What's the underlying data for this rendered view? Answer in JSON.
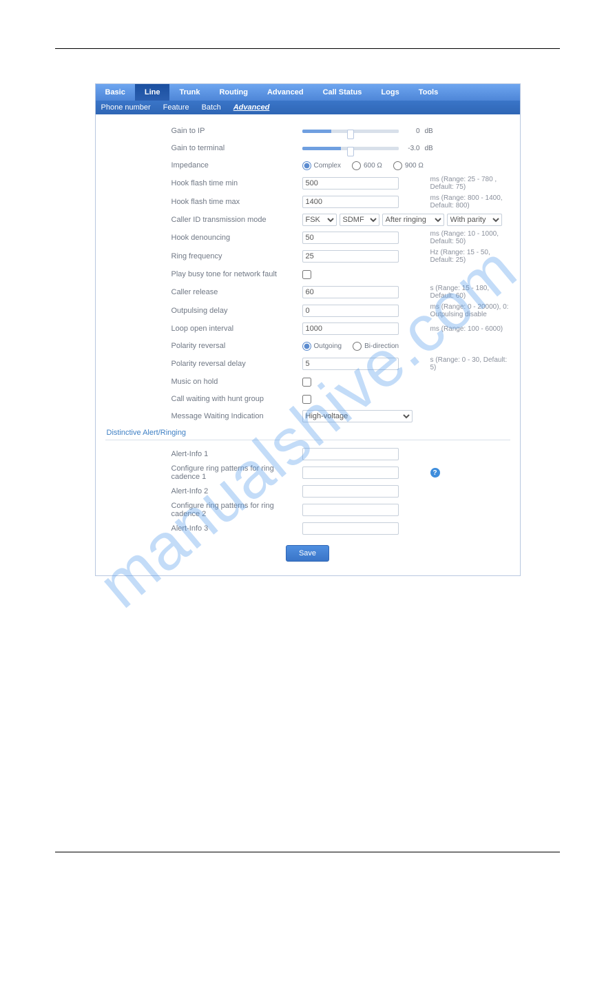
{
  "watermark": "manualshive.com",
  "tabs": [
    "Basic",
    "Line",
    "Trunk",
    "Routing",
    "Advanced",
    "Call Status",
    "Logs",
    "Tools"
  ],
  "active_tab": "Line",
  "subtabs": [
    "Phone number",
    "Feature",
    "Batch",
    "Advanced"
  ],
  "active_subtab": "Advanced",
  "form": {
    "gain_to_ip": {
      "label": "Gain to IP",
      "value": "0",
      "unit": "dB",
      "pos": 30
    },
    "gain_to_terminal": {
      "label": "Gain to terminal",
      "value": "-3.0",
      "unit": "dB",
      "pos": 40
    },
    "impedance": {
      "label": "Impedance",
      "options": [
        "Complex",
        "600 Ω",
        "900 Ω"
      ],
      "selected": "Complex"
    },
    "hook_flash_min": {
      "label": "Hook flash time min",
      "value": "500",
      "hint": "ms (Range: 25 - 780 , Default: 75)"
    },
    "hook_flash_max": {
      "label": "Hook flash time max",
      "value": "1400",
      "hint": "ms (Range: 800 - 1400, Default: 800)"
    },
    "cid_mode": {
      "label": "Caller ID transmission mode",
      "sel1": "FSK",
      "sel2": "SDMF",
      "sel3": "After ringing",
      "sel4": "With parity"
    },
    "hook_debouncing": {
      "label": "Hook denouncing",
      "value": "50",
      "hint": "ms (Range: 10 - 1000, Default: 50)"
    },
    "ring_freq": {
      "label": "Ring frequency",
      "value": "25",
      "hint": "Hz (Range: 15 - 50, Default: 25)"
    },
    "play_busy": {
      "label": "Play busy tone for network fault",
      "checked": false
    },
    "caller_release": {
      "label": "Caller release",
      "value": "60",
      "hint": "s (Range: 15 - 180, Default: 60)"
    },
    "outpulsing_delay": {
      "label": "Outpulsing delay",
      "value": "0",
      "hint": "ms (Range: 0 - 20000), 0: Outpulsing disable"
    },
    "loop_open": {
      "label": "Loop open interval",
      "value": "1000",
      "hint": "ms (Range: 100 - 6000)"
    },
    "polarity_reversal": {
      "label": "Polarity reversal",
      "options": [
        "Outgoing",
        "Bi-direction"
      ],
      "selected": "Outgoing"
    },
    "polarity_delay": {
      "label": "Polarity reversal delay",
      "value": "5",
      "hint": "s (Range: 0 - 30, Default: 5)"
    },
    "music_on_hold": {
      "label": "Music on hold",
      "checked": false
    },
    "call_waiting_hg": {
      "label": "Call waiting with hunt group",
      "checked": false
    },
    "mwi": {
      "label": "Message Waiting Indication",
      "value": "High-voltage"
    }
  },
  "section_title": "Distinctive Alert/Ringing",
  "distinctive": {
    "ai1": {
      "label": "Alert-Info 1",
      "value": ""
    },
    "cp1": {
      "label": "Configure ring patterns for ring cadence 1",
      "value": ""
    },
    "ai2": {
      "label": "Alert-Info 2",
      "value": ""
    },
    "cp2": {
      "label": "Configure ring patterns for ring cadence 2",
      "value": ""
    },
    "ai3": {
      "label": "Alert-Info 3",
      "value": ""
    }
  },
  "save_label": "Save"
}
